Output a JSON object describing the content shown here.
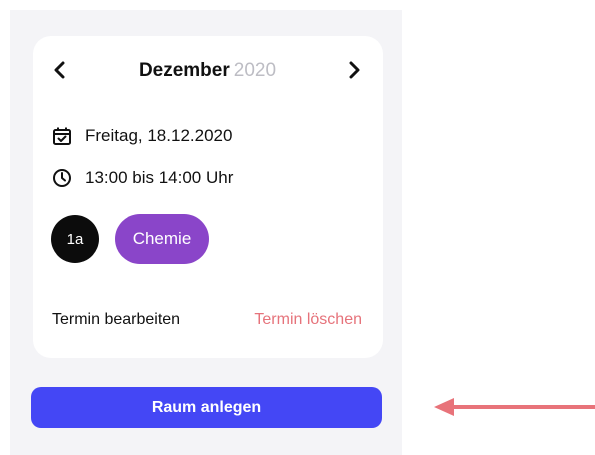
{
  "calendar": {
    "month": "Dezember",
    "year": "2020"
  },
  "appointment": {
    "date": "Freitag, 18.12.2020",
    "time": "13:00 bis 14:00 Uhr",
    "class_badge": "1a",
    "subject": "Chemie",
    "edit_label": "Termin bearbeiten",
    "delete_label": "Termin löschen"
  },
  "actions": {
    "create_room_label": "Raum anlegen"
  },
  "colors": {
    "primary": "#4447f5",
    "subject": "#8a45c9",
    "delete": "#e6737b",
    "annotation_arrow": "#e8737a"
  },
  "icons": {
    "prev": "chevron-left-icon",
    "next": "chevron-right-icon",
    "date": "calendar-check-icon",
    "time": "clock-icon",
    "annotation": "arrow-left-icon"
  }
}
